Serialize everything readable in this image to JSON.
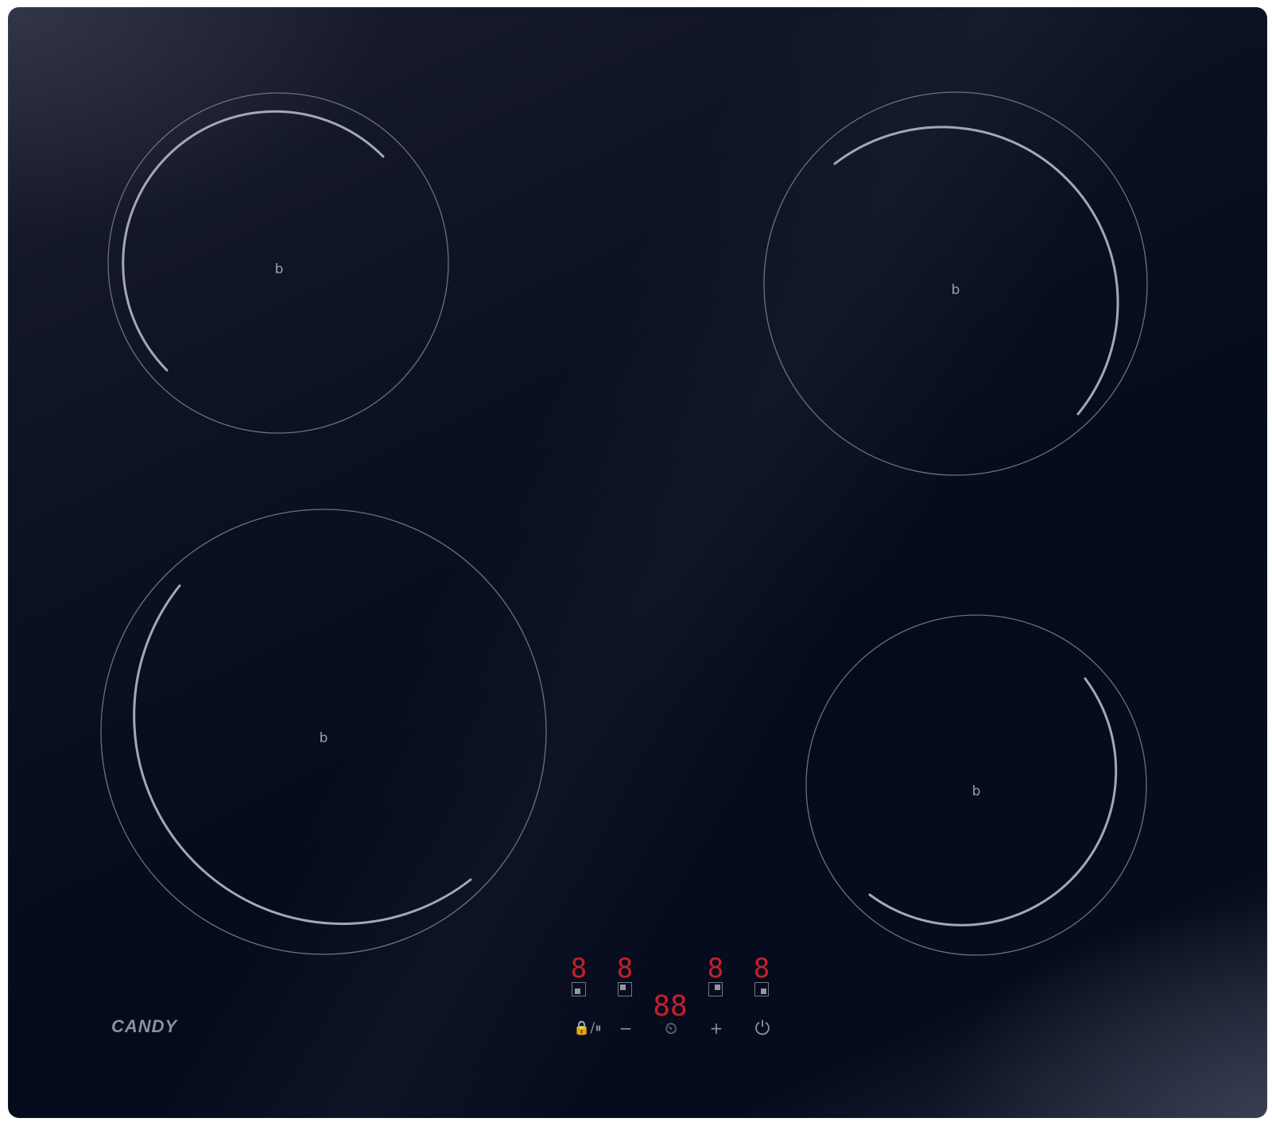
{
  "brand": {
    "logo_text": "CANDY"
  },
  "cooking_zones": [
    {
      "id": "front-left-rear",
      "symbol": "b"
    },
    {
      "id": "rear-right",
      "symbol": "b"
    },
    {
      "id": "front-left",
      "symbol": "b"
    },
    {
      "id": "front-right",
      "symbol": "b"
    }
  ],
  "control_panel": {
    "zone_displays": [
      "8",
      "8",
      "8",
      "8"
    ],
    "timer_display": "88",
    "buttons": {
      "lock_pause": "🔒/⏸",
      "minus": "−",
      "timer": "⏲",
      "plus": "+",
      "power": "⏻"
    }
  },
  "colors": {
    "glass": "#050b1c",
    "display_red": "#c4202a",
    "marking": "#9aa0ad"
  }
}
